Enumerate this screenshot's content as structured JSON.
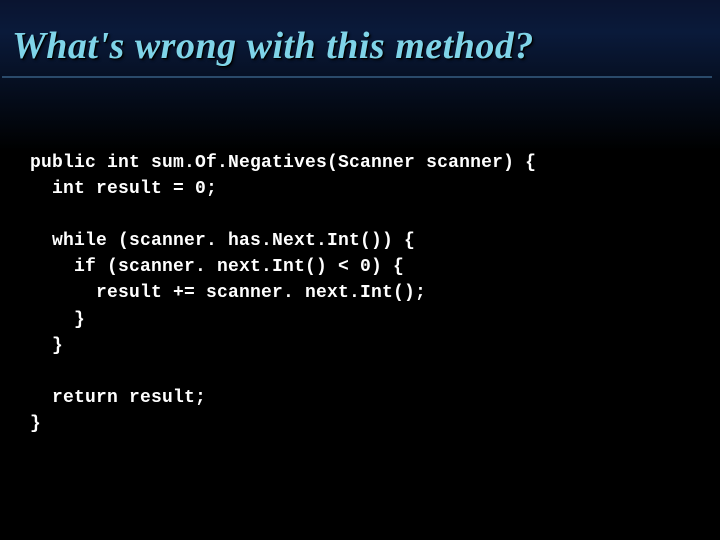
{
  "slide": {
    "title": "What's wrong with this method?",
    "code": "public int sum.Of.Negatives(Scanner scanner) {\n  int result = 0;\n\n  while (scanner. has.Next.Int()) {\n    if (scanner. next.Int() < 0) {\n      result += scanner. next.Int();\n    }\n  }\n\n  return result;\n}"
  }
}
